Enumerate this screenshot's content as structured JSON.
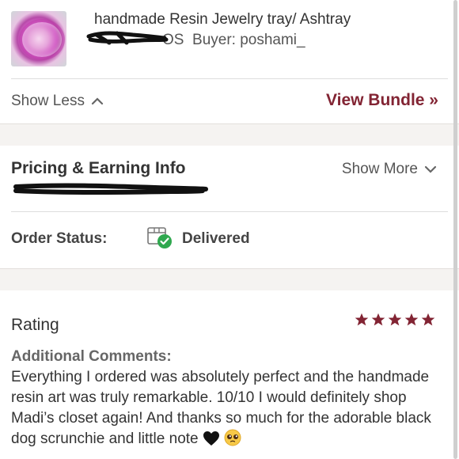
{
  "item": {
    "title": "handmade Resin Jewelry tray/ Ashtray",
    "size": "OS",
    "buyer": "Buyer: poshami_"
  },
  "actions": {
    "show_less": "Show Less",
    "view_bundle": "View Bundle »"
  },
  "pricing": {
    "title": "Pricing & Earning Info",
    "show_more": "Show More"
  },
  "order": {
    "label": "Order Status:",
    "status": "Delivered"
  },
  "rating": {
    "label": "Rating",
    "stars": 5,
    "comments_label": "Additional Comments:",
    "comments": "Everything I ordered was absolutely perfect and the handmade resin art was truly remarkable. 10/10 I would definitely shop Madi’s closet again! And thanks so much for the adorable black dog scrunchie and little note"
  },
  "colors": {
    "brand": "#822433",
    "delivered_check": "#2fa84f"
  },
  "icons": {
    "show_less": "chevron-up-icon",
    "show_more": "chevron-down-icon",
    "order_status": "package-delivered-icon",
    "star": "star-icon",
    "emoji_heart": "black-heart-emoji",
    "emoji_face": "pleading-face-emoji"
  }
}
